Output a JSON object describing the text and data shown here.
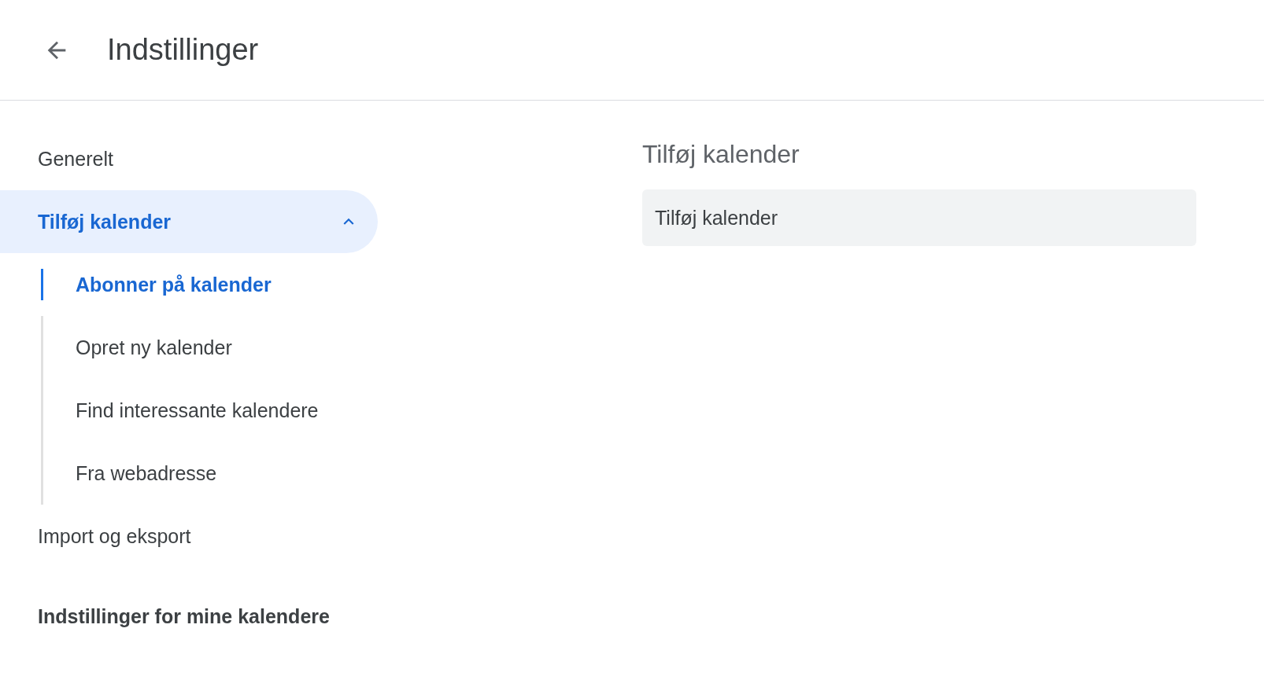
{
  "header": {
    "title": "Indstillinger"
  },
  "sidebar": {
    "items": [
      {
        "label": "Generelt",
        "selected": false
      },
      {
        "label": "Tilføj kalender",
        "selected": true,
        "expanded": true,
        "children": [
          {
            "label": "Abonner på kalender",
            "selected": true
          },
          {
            "label": "Opret ny kalender",
            "selected": false
          },
          {
            "label": "Find interessante kalendere",
            "selected": false
          },
          {
            "label": "Fra webadresse",
            "selected": false
          }
        ]
      },
      {
        "label": "Import og eksport",
        "selected": false
      }
    ],
    "section_heading": "Indstillinger for mine kalendere"
  },
  "content": {
    "heading": "Tilføj kalender",
    "field": {
      "value": "Tilføj kalender"
    }
  }
}
